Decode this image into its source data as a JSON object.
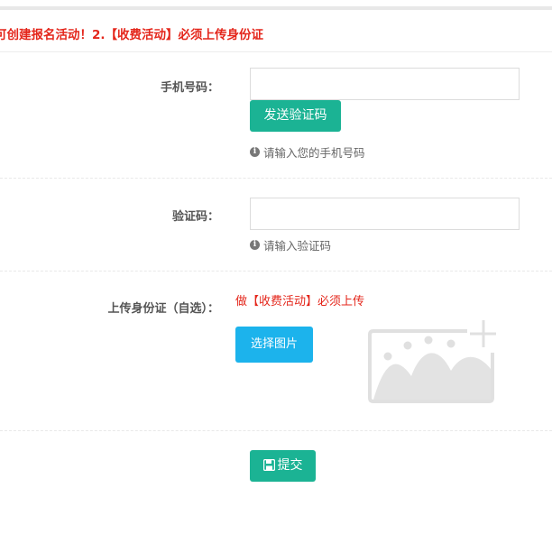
{
  "notice": {
    "text": "可创建报名活动！2.【收费活动】必须上传身份证"
  },
  "form": {
    "phone": {
      "label": "手机号码：",
      "value": "",
      "send_code_label": "发送验证码",
      "hint": "请输入您的手机号码"
    },
    "code": {
      "label": "验证码：",
      "value": "",
      "hint": "请输入验证码"
    },
    "id_upload": {
      "label": "上传身份证（自选）：",
      "note": "做【收费活动】必须上传",
      "choose_label": "选择图片"
    },
    "submit_label": "提交"
  },
  "colors": {
    "primary_green": "#1bb394",
    "upload_blue": "#1cb3ec",
    "alert_red": "#e4261b"
  },
  "icons": {
    "hint": "info-circle-icon",
    "submit": "floppy-disk-icon",
    "upload_preview": "image-placeholder-icon"
  }
}
